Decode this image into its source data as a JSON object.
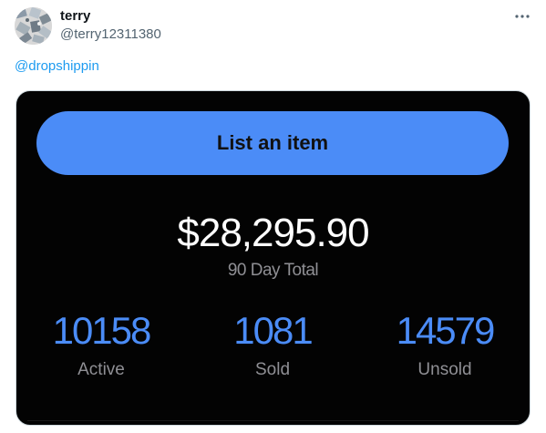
{
  "post": {
    "author_name": "terry",
    "author_handle": "@terry12311380",
    "text_mention": "@dropshippin",
    "more_icon": "more-horizontal-icon"
  },
  "card": {
    "button_label": "List an item",
    "total_amount": "$28,295.90",
    "total_label": "90 Day Total",
    "stats": [
      {
        "value": "10158",
        "label": "Active"
      },
      {
        "value": "1081",
        "label": "Sold"
      },
      {
        "value": "14579",
        "label": "Unsold"
      }
    ]
  },
  "colors": {
    "accent": "#4b8cf7",
    "mention": "#1d9bf0",
    "card_background": "#030303",
    "muted_text": "#8f8f94"
  }
}
